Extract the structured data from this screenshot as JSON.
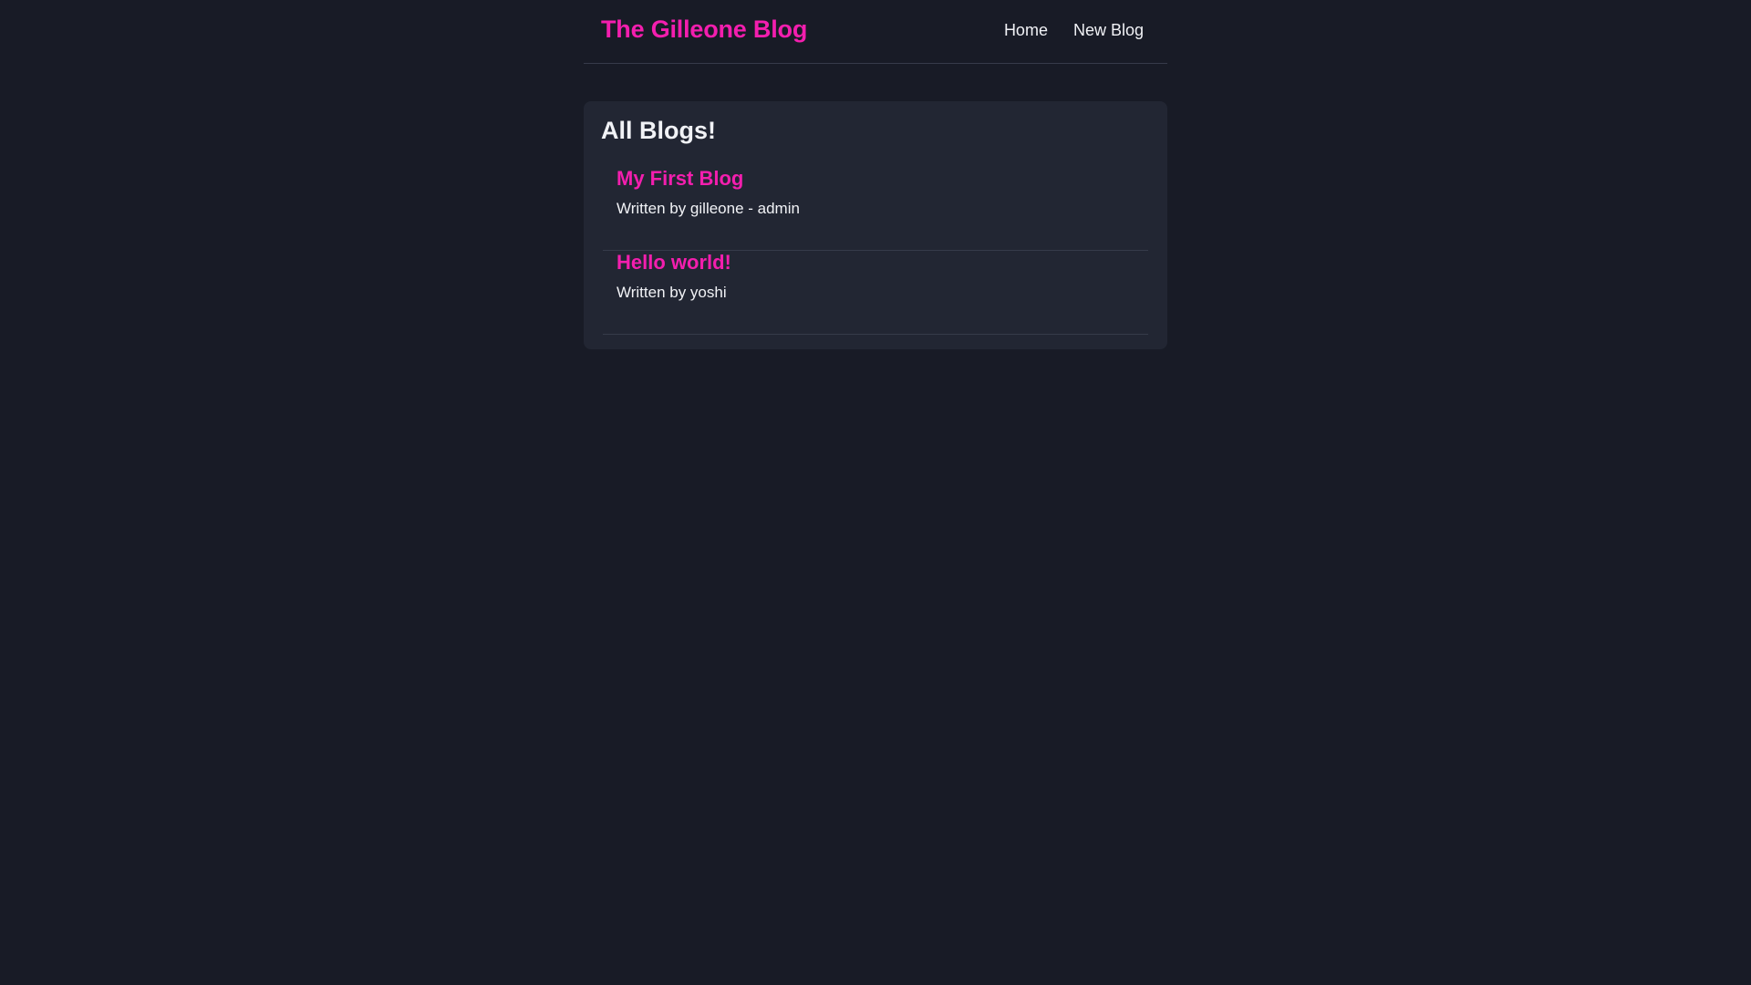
{
  "header": {
    "brand": "The Gilleone Blog",
    "nav": [
      {
        "label": "Home"
      },
      {
        "label": "New Blog"
      }
    ]
  },
  "main": {
    "heading": "All Blogs!",
    "blogs": [
      {
        "title": "My First Blog",
        "author_line": "Written by gilleone - admin"
      },
      {
        "title": "Hello world!",
        "author_line": "Written by yoshi"
      }
    ]
  },
  "colors": {
    "background": "#181b26",
    "card": "#222633",
    "accent": "#f31eae",
    "text": "#f1f2f6",
    "divider": "#363b4a"
  }
}
